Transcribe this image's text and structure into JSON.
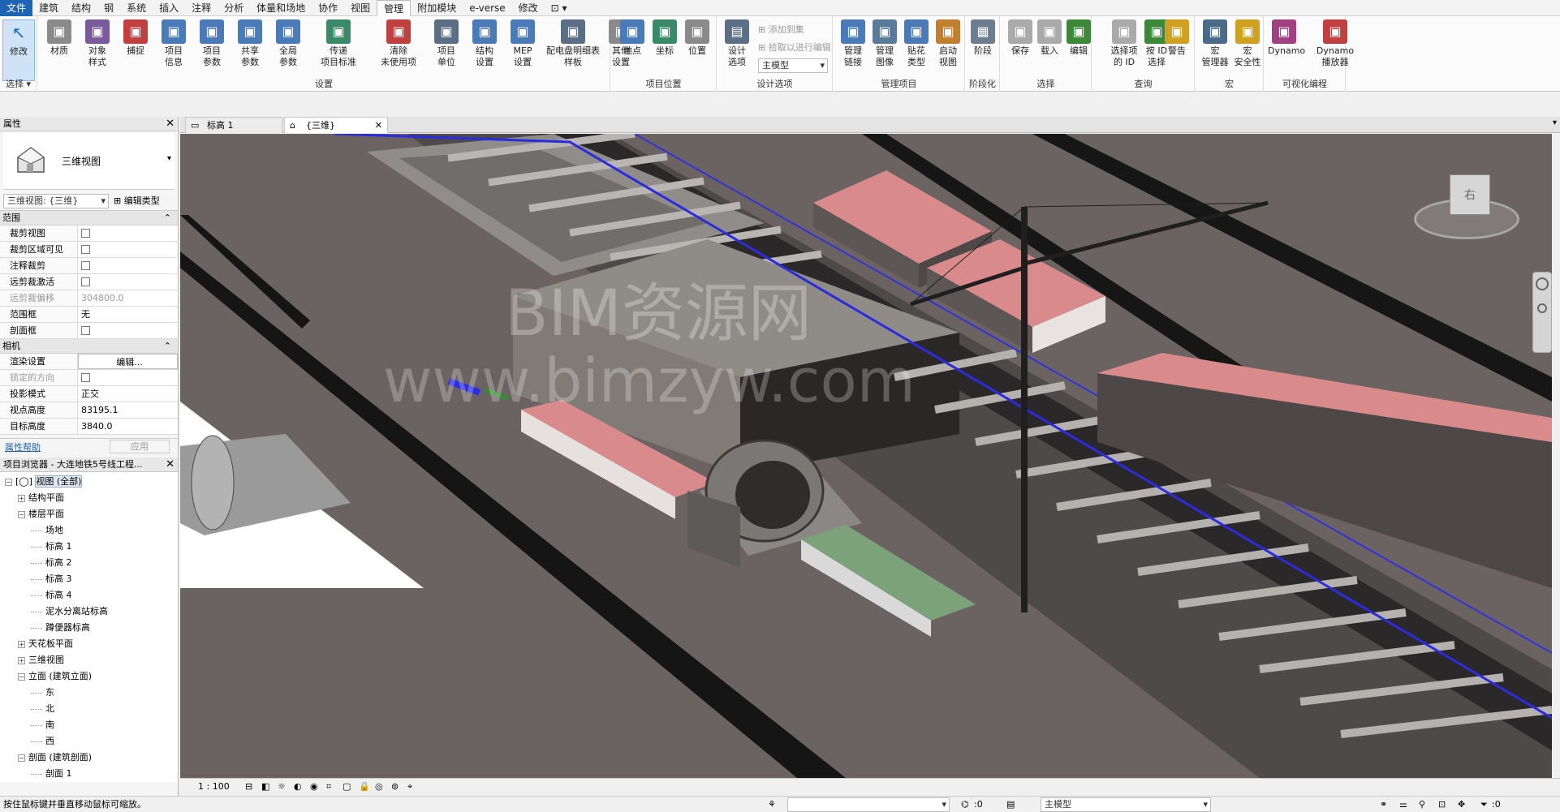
{
  "menu": [
    "文件",
    "建筑",
    "结构",
    "钢",
    "系统",
    "插入",
    "注释",
    "分析",
    "体量和场地",
    "协作",
    "视图",
    "管理",
    "附加模块",
    "e-verse",
    "修改",
    "⊡ ▾"
  ],
  "ribbon": {
    "select_group": {
      "modify": "修改",
      "title": "选择"
    },
    "settings": {
      "title": "设置",
      "tools": [
        "材质",
        "对象\n样式",
        "捕捉",
        "项目\n信息",
        "项目\n参数",
        "共享\n参数",
        "全局\n参数",
        "传递\n项目标准",
        "清除\n未使用项",
        "项目\n单位",
        "结构\n设置",
        "MEP\n设置",
        "配电盘明细表\n样板",
        "其他\n设置"
      ]
    },
    "location": {
      "title": "项目位置",
      "tools": [
        "地点",
        "坐标",
        "位置"
      ]
    },
    "design": {
      "title": "设计选项",
      "tool": "设计\n选项",
      "add_to_set": "添加到集",
      "pick_to_edit": "拾取以进行编辑",
      "combo_value": "主模型"
    },
    "manage": {
      "title": "管理项目",
      "tools": [
        "管理\n链接",
        "管理\n图像",
        "贴花\n类型",
        "启动\n视图"
      ]
    },
    "phase": {
      "title": "阶段化",
      "tool": "阶段"
    },
    "selection": {
      "title": "选择",
      "tools": [
        "保存",
        "载入",
        "编辑"
      ]
    },
    "inquiry": {
      "title": "查询",
      "tools": [
        "选择项\n的 ID",
        "按 ID\n选择",
        "警告"
      ]
    },
    "macros": {
      "title": "宏",
      "tools": [
        "宏\n管理器",
        "宏\n安全性"
      ]
    },
    "visual": {
      "title": "可视化编程",
      "tools": [
        "Dynamo",
        "Dynamo\n播放器"
      ]
    }
  },
  "properties": {
    "title": "属性",
    "type_name": "三维视图",
    "selector": "三维视图: {三维}",
    "edit_type": "编辑类型",
    "category_extents": "范围",
    "category_camera": "相机",
    "rows_extents": [
      {
        "label": "裁剪视图",
        "value": "",
        "check": true
      },
      {
        "label": "裁剪区域可见",
        "value": "",
        "check": true
      },
      {
        "label": "注释裁剪",
        "value": "",
        "check": true
      },
      {
        "label": "远剪裁激活",
        "value": "",
        "check": true
      },
      {
        "label": "远剪裁偏移",
        "value": "304800.0",
        "check": false,
        "dim": true
      },
      {
        "label": "范围框",
        "value": "无",
        "check": false
      },
      {
        "label": "剖面框",
        "value": "",
        "check": true
      }
    ],
    "rows_camera": [
      {
        "label": "渲染设置",
        "value": "编辑...",
        "check": false
      },
      {
        "label": "锁定的方向",
        "value": "",
        "check": true,
        "dim": true
      },
      {
        "label": "投影模式",
        "value": "正交",
        "check": false
      },
      {
        "label": "视点高度",
        "value": "83195.1",
        "check": false
      },
      {
        "label": "目标高度",
        "value": "3840.0",
        "check": false
      }
    ],
    "help_link": "属性帮助",
    "apply": "应用"
  },
  "browser": {
    "title": "项目浏览器 - 大连地铁5号线工程...",
    "items": [
      {
        "label": "视图 (全部)",
        "indent": 0,
        "exp": "−",
        "root": true
      },
      {
        "label": "结构平面",
        "indent": 1,
        "exp": "+"
      },
      {
        "label": "楼层平面",
        "indent": 1,
        "exp": "−"
      },
      {
        "label": "场地",
        "indent": 2,
        "exp": ""
      },
      {
        "label": "标高 1",
        "indent": 2,
        "exp": ""
      },
      {
        "label": "标高 2",
        "indent": 2,
        "exp": ""
      },
      {
        "label": "标高 3",
        "indent": 2,
        "exp": ""
      },
      {
        "label": "标高 4",
        "indent": 2,
        "exp": ""
      },
      {
        "label": "泥水分离站标高",
        "indent": 2,
        "exp": ""
      },
      {
        "label": "蹲便器标高",
        "indent": 2,
        "exp": ""
      },
      {
        "label": "天花板平面",
        "indent": 1,
        "exp": "+"
      },
      {
        "label": "三维视图",
        "indent": 1,
        "exp": "+"
      },
      {
        "label": "立面 (建筑立面)",
        "indent": 1,
        "exp": "−"
      },
      {
        "label": "东",
        "indent": 2,
        "exp": ""
      },
      {
        "label": "北",
        "indent": 2,
        "exp": ""
      },
      {
        "label": "南",
        "indent": 2,
        "exp": ""
      },
      {
        "label": "西",
        "indent": 2,
        "exp": ""
      },
      {
        "label": "剖面 (建筑剖面)",
        "indent": 1,
        "exp": "−"
      },
      {
        "label": "剖面 1",
        "indent": 2,
        "exp": ""
      }
    ]
  },
  "tabs": [
    {
      "label": "标高 1",
      "active": false
    },
    {
      "label": "{三维}",
      "active": true
    }
  ],
  "viewport": {
    "watermark_1": "BIM资源网",
    "watermark_2": "www.bimzyw.com",
    "viewcube_text": "右"
  },
  "view_control": {
    "scale": "1 : 100"
  },
  "status": {
    "message": "按住鼠标键并垂直移动鼠标可缩放。",
    "count1": ":0",
    "model": "主模型",
    "count2": ":0"
  },
  "colors": {
    "accent": "#1e64b4",
    "viewport_bg": "#6a6362",
    "roof": "#d98a8a"
  }
}
